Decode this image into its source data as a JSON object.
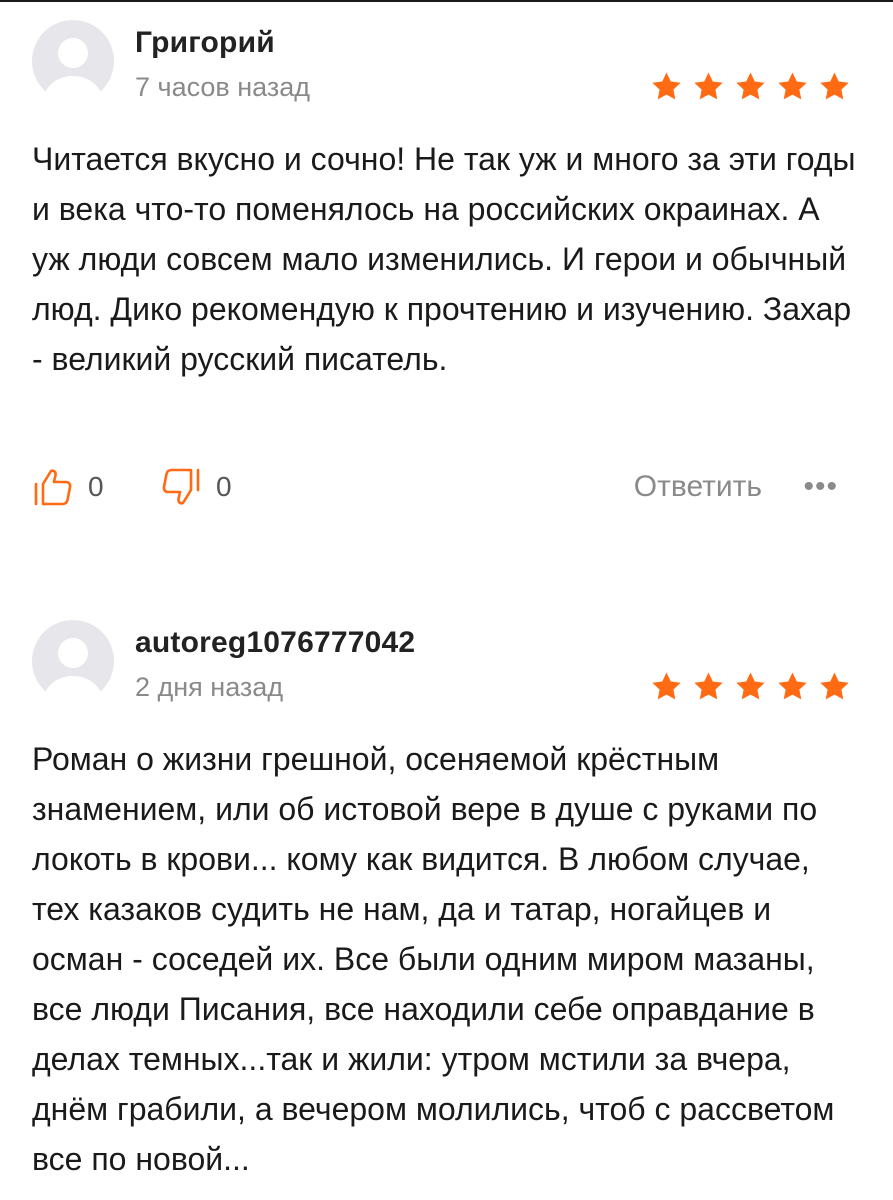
{
  "reviews": [
    {
      "author": "Григорий",
      "time": "7 часов назад",
      "rating": 5,
      "text": "Читается вкусно и сочно! Не так уж и много за эти годы и века что-то поменялось на российских окраинах. А уж люди совсем мало изменились. И герои и обычный люд. Дико рекомендую к прочтению и изучению. Захар - великий русский писатель.",
      "likes": "0",
      "dislikes": "0",
      "reply_label": "Ответить",
      "more_label": "•••"
    },
    {
      "author": "autoreg1076777042",
      "time": "2 дня назад",
      "rating": 5,
      "text": "Роман о жизни грешной, осеняемой крёстным знамением, или об истовой вере в душе с руками по локоть в крови... кому как видится. В любом случае, тех казаков судить не нам, да и татар, ногайцев и осман - соседей их. Все были одним миром мазаны, все люди Писания, все находили себе оправдание в делах темных...так и жили: утром мстили за вчера, днём грабили, а вечером молились, чтоб с рассветом все по новой..."
    }
  ],
  "colors": {
    "star": "#ff6a13",
    "avatar_bg": "#e6e6eb",
    "avatar_fg": "#ffffff",
    "muted_text": "#8a8a8a"
  },
  "icons": {
    "like": "thumbs-up-icon",
    "dislike": "thumbs-down-icon",
    "avatar": "user-silhouette-icon",
    "star": "star-icon",
    "more": "more-horizontal-icon"
  }
}
